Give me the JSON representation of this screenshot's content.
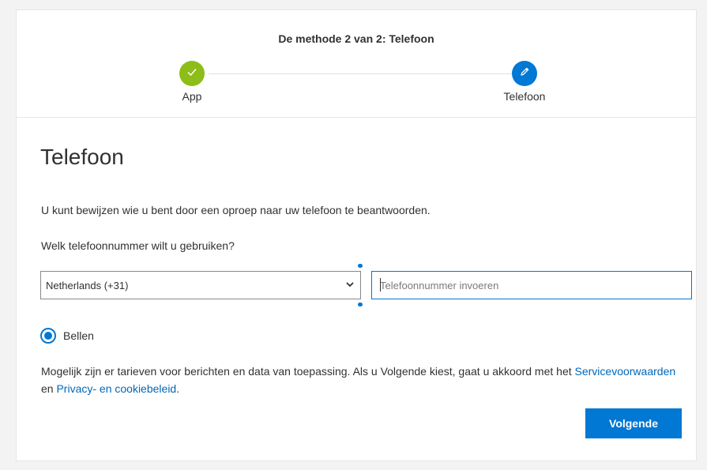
{
  "wizard": {
    "step_title": "De methode 2 van 2: Telefoon",
    "steps": [
      {
        "label": "App",
        "state": "done"
      },
      {
        "label": "Telefoon",
        "state": "active"
      }
    ]
  },
  "main": {
    "title": "Telefoon",
    "description": "U kunt bewijzen wie u bent door een oproep naar uw telefoon te beantwoorden.",
    "question": "Welk telefoonnummer wilt u gebruiken?",
    "country_select": {
      "value": "Netherlands (+31)"
    },
    "phone_input": {
      "placeholder": "Telefoonnummer invoeren",
      "value": ""
    },
    "method_option": {
      "label": "Bellen",
      "selected": true
    },
    "notice": {
      "text_before": "Mogelijk zijn er tarieven voor berichten en data van toepassing. Als u Volgende kiest, gaat u akkoord met het",
      "terms_link": "Servicevoorwaarden",
      "connector": "en",
      "privacy_link": "Privacy- en cookiebeleid",
      "end": "."
    },
    "next_button": "Volgende"
  },
  "colors": {
    "accent": "#0078d4",
    "success": "#8cbd18",
    "link": "#0067b8"
  }
}
